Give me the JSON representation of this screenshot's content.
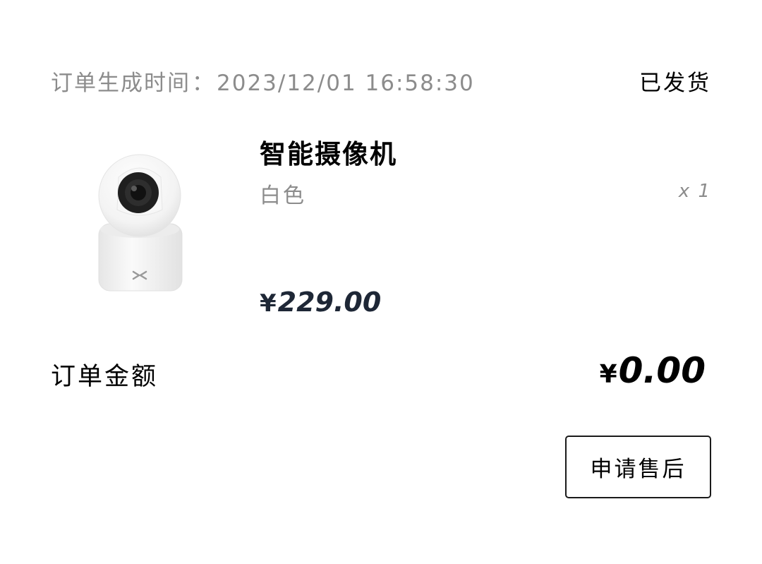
{
  "order": {
    "time_label": "订单生成时间",
    "time_separator": "：",
    "time_value": "2023/12/01 16:58:30",
    "status": "已发货"
  },
  "product": {
    "image_alt": "security-camera",
    "name": "智能摄像机",
    "spec": "白色",
    "quantity": "x 1",
    "currency": "¥",
    "price": "229.00"
  },
  "total": {
    "label": "订单金额",
    "currency": "¥",
    "amount": "0.00"
  },
  "actions": {
    "after_sale_label": "申请售后"
  }
}
